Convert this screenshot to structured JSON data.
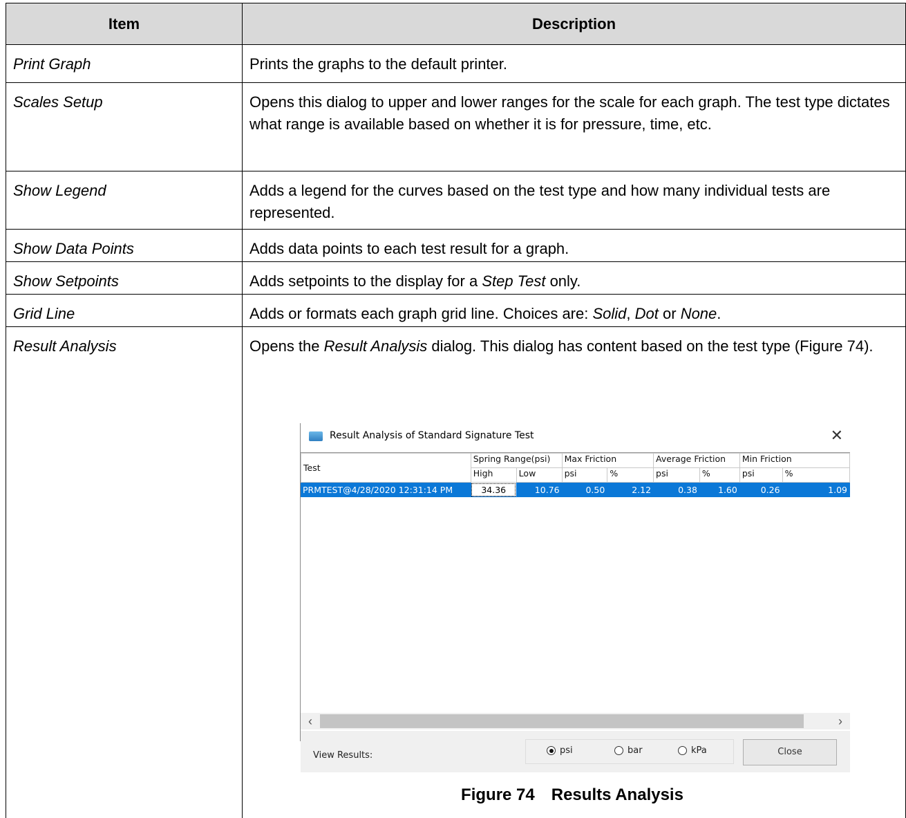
{
  "table": {
    "header_item": "Item",
    "header_description": "Description",
    "rows": [
      {
        "item": "Print Graph",
        "desc": "Prints the graphs to the default printer."
      },
      {
        "item": "Scales Setup",
        "desc": "Opens this dialog to upper and lower ranges for the scale for each graph. The test type dictates what range is available based on whether it is for pressure, time, etc."
      },
      {
        "item": "Show Legend",
        "desc": "Adds a legend for the curves based on the test type and how many individual tests are represented."
      },
      {
        "item": "Show Data Points",
        "desc": "Adds data points to each test result for a graph."
      },
      {
        "item": "Show Setpoints",
        "desc_pre": "Adds setpoints to the display for a ",
        "desc_em": "Step Test",
        "desc_post": " only."
      },
      {
        "item": "Grid Line",
        "desc_pre": "Adds or formats each graph grid line. Choices are: ",
        "em1": "Solid",
        "mid1": ", ",
        "em2": "Dot",
        "mid2": " or ",
        "em3": "None",
        "desc_post": "."
      },
      {
        "item": "Result Analysis",
        "desc_pre": "Opens the ",
        "desc_em": "Result Analysis",
        "desc_post": " dialog. This dialog has content based on the test type (Figure 74)."
      }
    ]
  },
  "dialog": {
    "title": "Result Analysis of Standard Signature Test",
    "close_glyph": "✕",
    "group_headers": {
      "test": "Test",
      "spring": "Spring Range(psi)",
      "max": "Max Friction",
      "avg": "Average Friction",
      "min": "Min Friction"
    },
    "sub_headers": [
      "High",
      "Low",
      "psi",
      "%",
      "psi",
      "%",
      "psi",
      "%"
    ],
    "row": {
      "name": "PRMTEST@4/28/2020 12:31:14 PM",
      "values": [
        "34.36",
        "10.76",
        "0.50",
        "2.12",
        "0.38",
        "1.60",
        "0.26",
        "1.09"
      ]
    },
    "view_results_label": "View Results:",
    "units": [
      "psi",
      "bar",
      "kPa"
    ],
    "selected_unit": "psi",
    "close_button": "Close"
  },
  "caption": {
    "number": "Figure 74",
    "title": "Results Analysis"
  }
}
